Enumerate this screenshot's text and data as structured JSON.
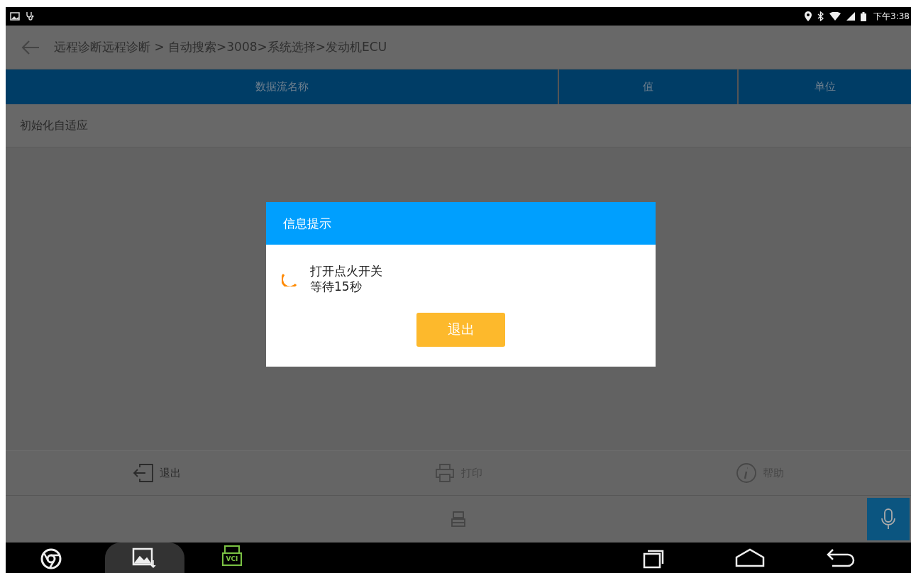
{
  "status_bar": {
    "time": "下午3:38"
  },
  "header": {
    "breadcrumb": "远程诊断远程诊断 > 自动搜索>3008>系统选择>发动机ECU"
  },
  "table": {
    "columns": [
      "数据流名称",
      "值",
      "单位"
    ],
    "rows": [
      {
        "name": "初始化自适应"
      }
    ]
  },
  "toolbar": [
    {
      "label": "退出",
      "kind": "exit",
      "disabled": false
    },
    {
      "label": "打印",
      "kind": "print",
      "disabled": true
    },
    {
      "label": "帮助",
      "kind": "help",
      "disabled": true
    }
  ],
  "taskbar": {
    "vci_label": "VCI"
  },
  "dialog": {
    "title": "信息提示",
    "lines": [
      "打开点火开关",
      "等待15秒"
    ],
    "button": "退出"
  }
}
